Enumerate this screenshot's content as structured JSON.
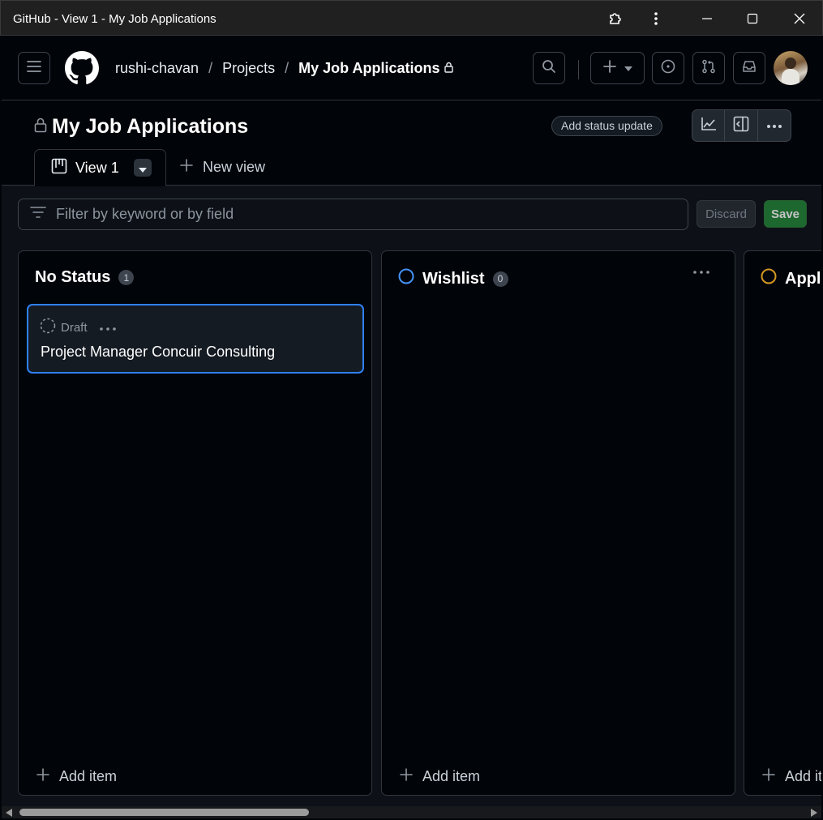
{
  "window": {
    "title": "GitHub - View 1 - My Job Applications"
  },
  "header": {
    "breadcrumb": {
      "owner": "rushi-chavan",
      "section": "Projects",
      "project": "My Job Applications"
    },
    "icons": [
      "menu-icon",
      "github-logo",
      "search-icon",
      "plus-icon",
      "issues-icon",
      "pull-requests-icon",
      "inbox-icon",
      "avatar"
    ]
  },
  "project": {
    "title": "My Job Applications",
    "status_button": "Add status update"
  },
  "tabs": {
    "active": "View 1",
    "new_view": "New view"
  },
  "filter": {
    "placeholder": "Filter by keyword or by field",
    "value": ""
  },
  "actions": {
    "discard": "Discard",
    "save": "Save"
  },
  "columns": [
    {
      "name": "No Status",
      "count": "1",
      "add_item": "Add item",
      "cards": [
        {
          "status": "Draft",
          "title": "Project Manager Concuir Consulting"
        }
      ]
    },
    {
      "name": "Wishlist",
      "count": "0",
      "add_item": "Add item",
      "cards": []
    },
    {
      "name": "Applied",
      "count": "",
      "add_item": "Add item",
      "cards": []
    }
  ],
  "colors": {
    "accent_blue": "#2f81f7",
    "wishlist_circle": "#4493f8",
    "applied_circle": "#d29922",
    "save_green": "#238636"
  }
}
